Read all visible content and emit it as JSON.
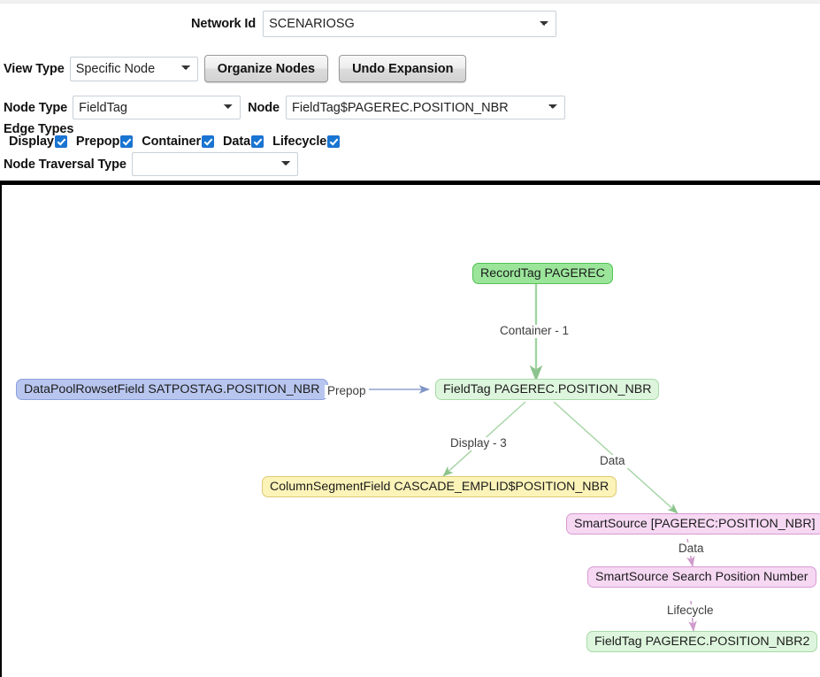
{
  "form": {
    "network_id": {
      "label": "Network Id",
      "value": "SCENARIOSG",
      "options": [
        "SCENARIOSG"
      ]
    },
    "view_type": {
      "label": "View Type",
      "value": "Specific Node",
      "options": [
        "Specific Node"
      ]
    },
    "organize_button": "Organize Nodes",
    "undo_button": "Undo Expansion",
    "node_type": {
      "label": "Node Type",
      "value": "FieldTag",
      "options": [
        "FieldTag"
      ]
    },
    "node": {
      "label": "Node",
      "value": "FieldTag$PAGEREC.POSITION_NBR",
      "options": [
        "FieldTag$PAGEREC.POSITION_NBR"
      ]
    },
    "edge_types": {
      "label": "Edge Types",
      "items": [
        {
          "label": "Display",
          "checked": true
        },
        {
          "label": "Prepop",
          "checked": true
        },
        {
          "label": "Container",
          "checked": true
        },
        {
          "label": "Data",
          "checked": true
        },
        {
          "label": "Lifecycle",
          "checked": true
        }
      ]
    },
    "traversal": {
      "label": "Node Traversal Type",
      "value": "",
      "options": [
        ""
      ]
    }
  },
  "graph": {
    "nodes": [
      {
        "id": "recordtag",
        "label": "RecordTag PAGEREC"
      },
      {
        "id": "datapool",
        "label": "DataPoolRowsetField SATPOSTAG.POSITION_NBR"
      },
      {
        "id": "fieldtag",
        "label": "FieldTag PAGEREC.POSITION_NBR"
      },
      {
        "id": "colsegment",
        "label": "ColumnSegmentField CASCADE_EMPLID$POSITION_NBR"
      },
      {
        "id": "smartsource",
        "label": "SmartSource [PAGEREC:POSITION_NBR]"
      },
      {
        "id": "smartsearch",
        "label": "SmartSource Search Position Number"
      },
      {
        "id": "fieldtag2",
        "label": "FieldTag PAGEREC.POSITION_NBR2"
      }
    ],
    "edges": [
      {
        "id": "e-container",
        "label": "Container - 1",
        "from": "recordtag",
        "to": "fieldtag"
      },
      {
        "id": "e-prepop",
        "label": "Prepop",
        "from": "datapool",
        "to": "fieldtag"
      },
      {
        "id": "e-display",
        "label": "Display - 3",
        "from": "fieldtag",
        "to": "colsegment"
      },
      {
        "id": "e-data1",
        "label": "Data",
        "from": "fieldtag",
        "to": "smartsource"
      },
      {
        "id": "e-data2",
        "label": "Data",
        "from": "smartsource",
        "to": "smartsearch"
      },
      {
        "id": "e-lifecycle",
        "label": "Lifecycle",
        "from": "smartsearch",
        "to": "fieldtag2"
      }
    ],
    "colors": {
      "green_edge": "#a9d6a9",
      "blue_edge": "#8fa3cf",
      "pink_edge": "#d9a8d6",
      "node_green_strong": "#9be59b",
      "node_green_light": "#ddf5dd",
      "node_blue": "#b8c6ef",
      "node_yellow": "#fcf3b8",
      "node_pink": "#f6d8f3"
    }
  }
}
